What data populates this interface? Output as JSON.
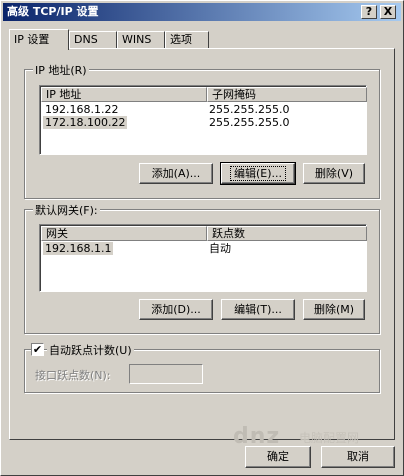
{
  "title": "高级 TCP/IP 设置",
  "title_buttons": {
    "help": "?",
    "close": "X"
  },
  "tabs": [
    "IP 设置",
    "DNS",
    "WINS",
    "选项"
  ],
  "ip_group": {
    "legend": "IP 地址(R)",
    "columns": [
      "IP 地址",
      "子网掩码"
    ],
    "rows": [
      [
        "192.168.1.22",
        "255.255.255.0"
      ],
      [
        "172.18.100.22",
        "255.255.255.0"
      ]
    ],
    "buttons": {
      "add": "添加(A)...",
      "edit": "编辑(E)...",
      "delete": "删除(V)"
    }
  },
  "gateway_group": {
    "legend": "默认网关(F):",
    "columns": [
      "网关",
      "跃点数"
    ],
    "rows": [
      [
        "192.168.1.1",
        "自动"
      ]
    ],
    "buttons": {
      "add": "添加(D)...",
      "edit": "编辑(T)...",
      "delete": "删除(M)"
    }
  },
  "auto_metric": {
    "label": "自动跃点计数(U)",
    "checked": true,
    "check_glyph": "✔",
    "interface_metric_label": "接口跃点数(N):",
    "interface_metric_value": ""
  },
  "footer": {
    "ok": "确定",
    "cancel": "取消"
  },
  "watermark": {
    "logo": "dnz",
    "site": "电脑配置网"
  }
}
